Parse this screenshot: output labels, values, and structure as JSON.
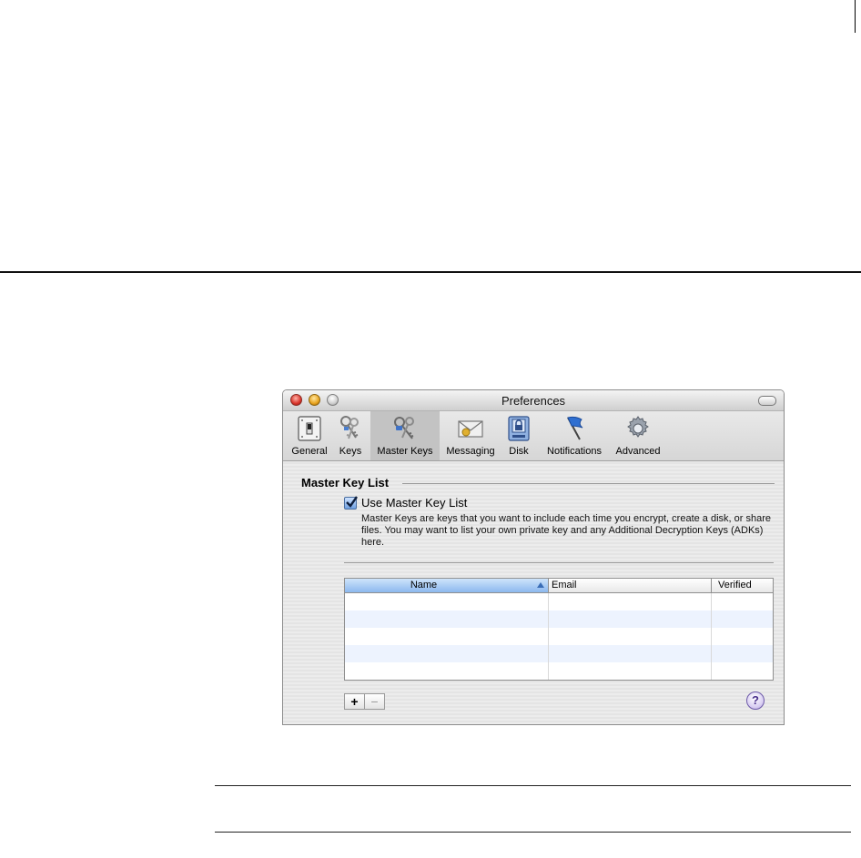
{
  "window": {
    "title": "Preferences"
  },
  "toolbar": {
    "items": [
      {
        "label": "General",
        "icon": "light-switch-icon"
      },
      {
        "label": "Keys",
        "icon": "keys-icon"
      },
      {
        "label": "Master Keys",
        "icon": "master-keys-icon",
        "selected": true
      },
      {
        "label": "Messaging",
        "icon": "envelope-icon"
      },
      {
        "label": "Disk",
        "icon": "disk-lock-icon"
      },
      {
        "label": "Notifications",
        "icon": "flag-icon"
      },
      {
        "label": "Advanced",
        "icon": "gear-icon"
      }
    ]
  },
  "section": {
    "title": "Master Key List",
    "checkbox_label": "Use Master Key List",
    "checkbox_checked": true,
    "description": "Master Keys are keys that you want to include each time you encrypt, create a disk, or share files. You may want to list your own private key and any Additional Decryption Keys (ADKs) here."
  },
  "table": {
    "columns": [
      "Name",
      "Email",
      "Verified"
    ],
    "sort_column": "Name",
    "sort_direction": "ascending",
    "rows": []
  },
  "buttons": {
    "add": "+",
    "remove": "−",
    "help": "?"
  },
  "colors": {
    "selection_header": "#8cb8ee",
    "alt_row": "#edf3fe"
  }
}
